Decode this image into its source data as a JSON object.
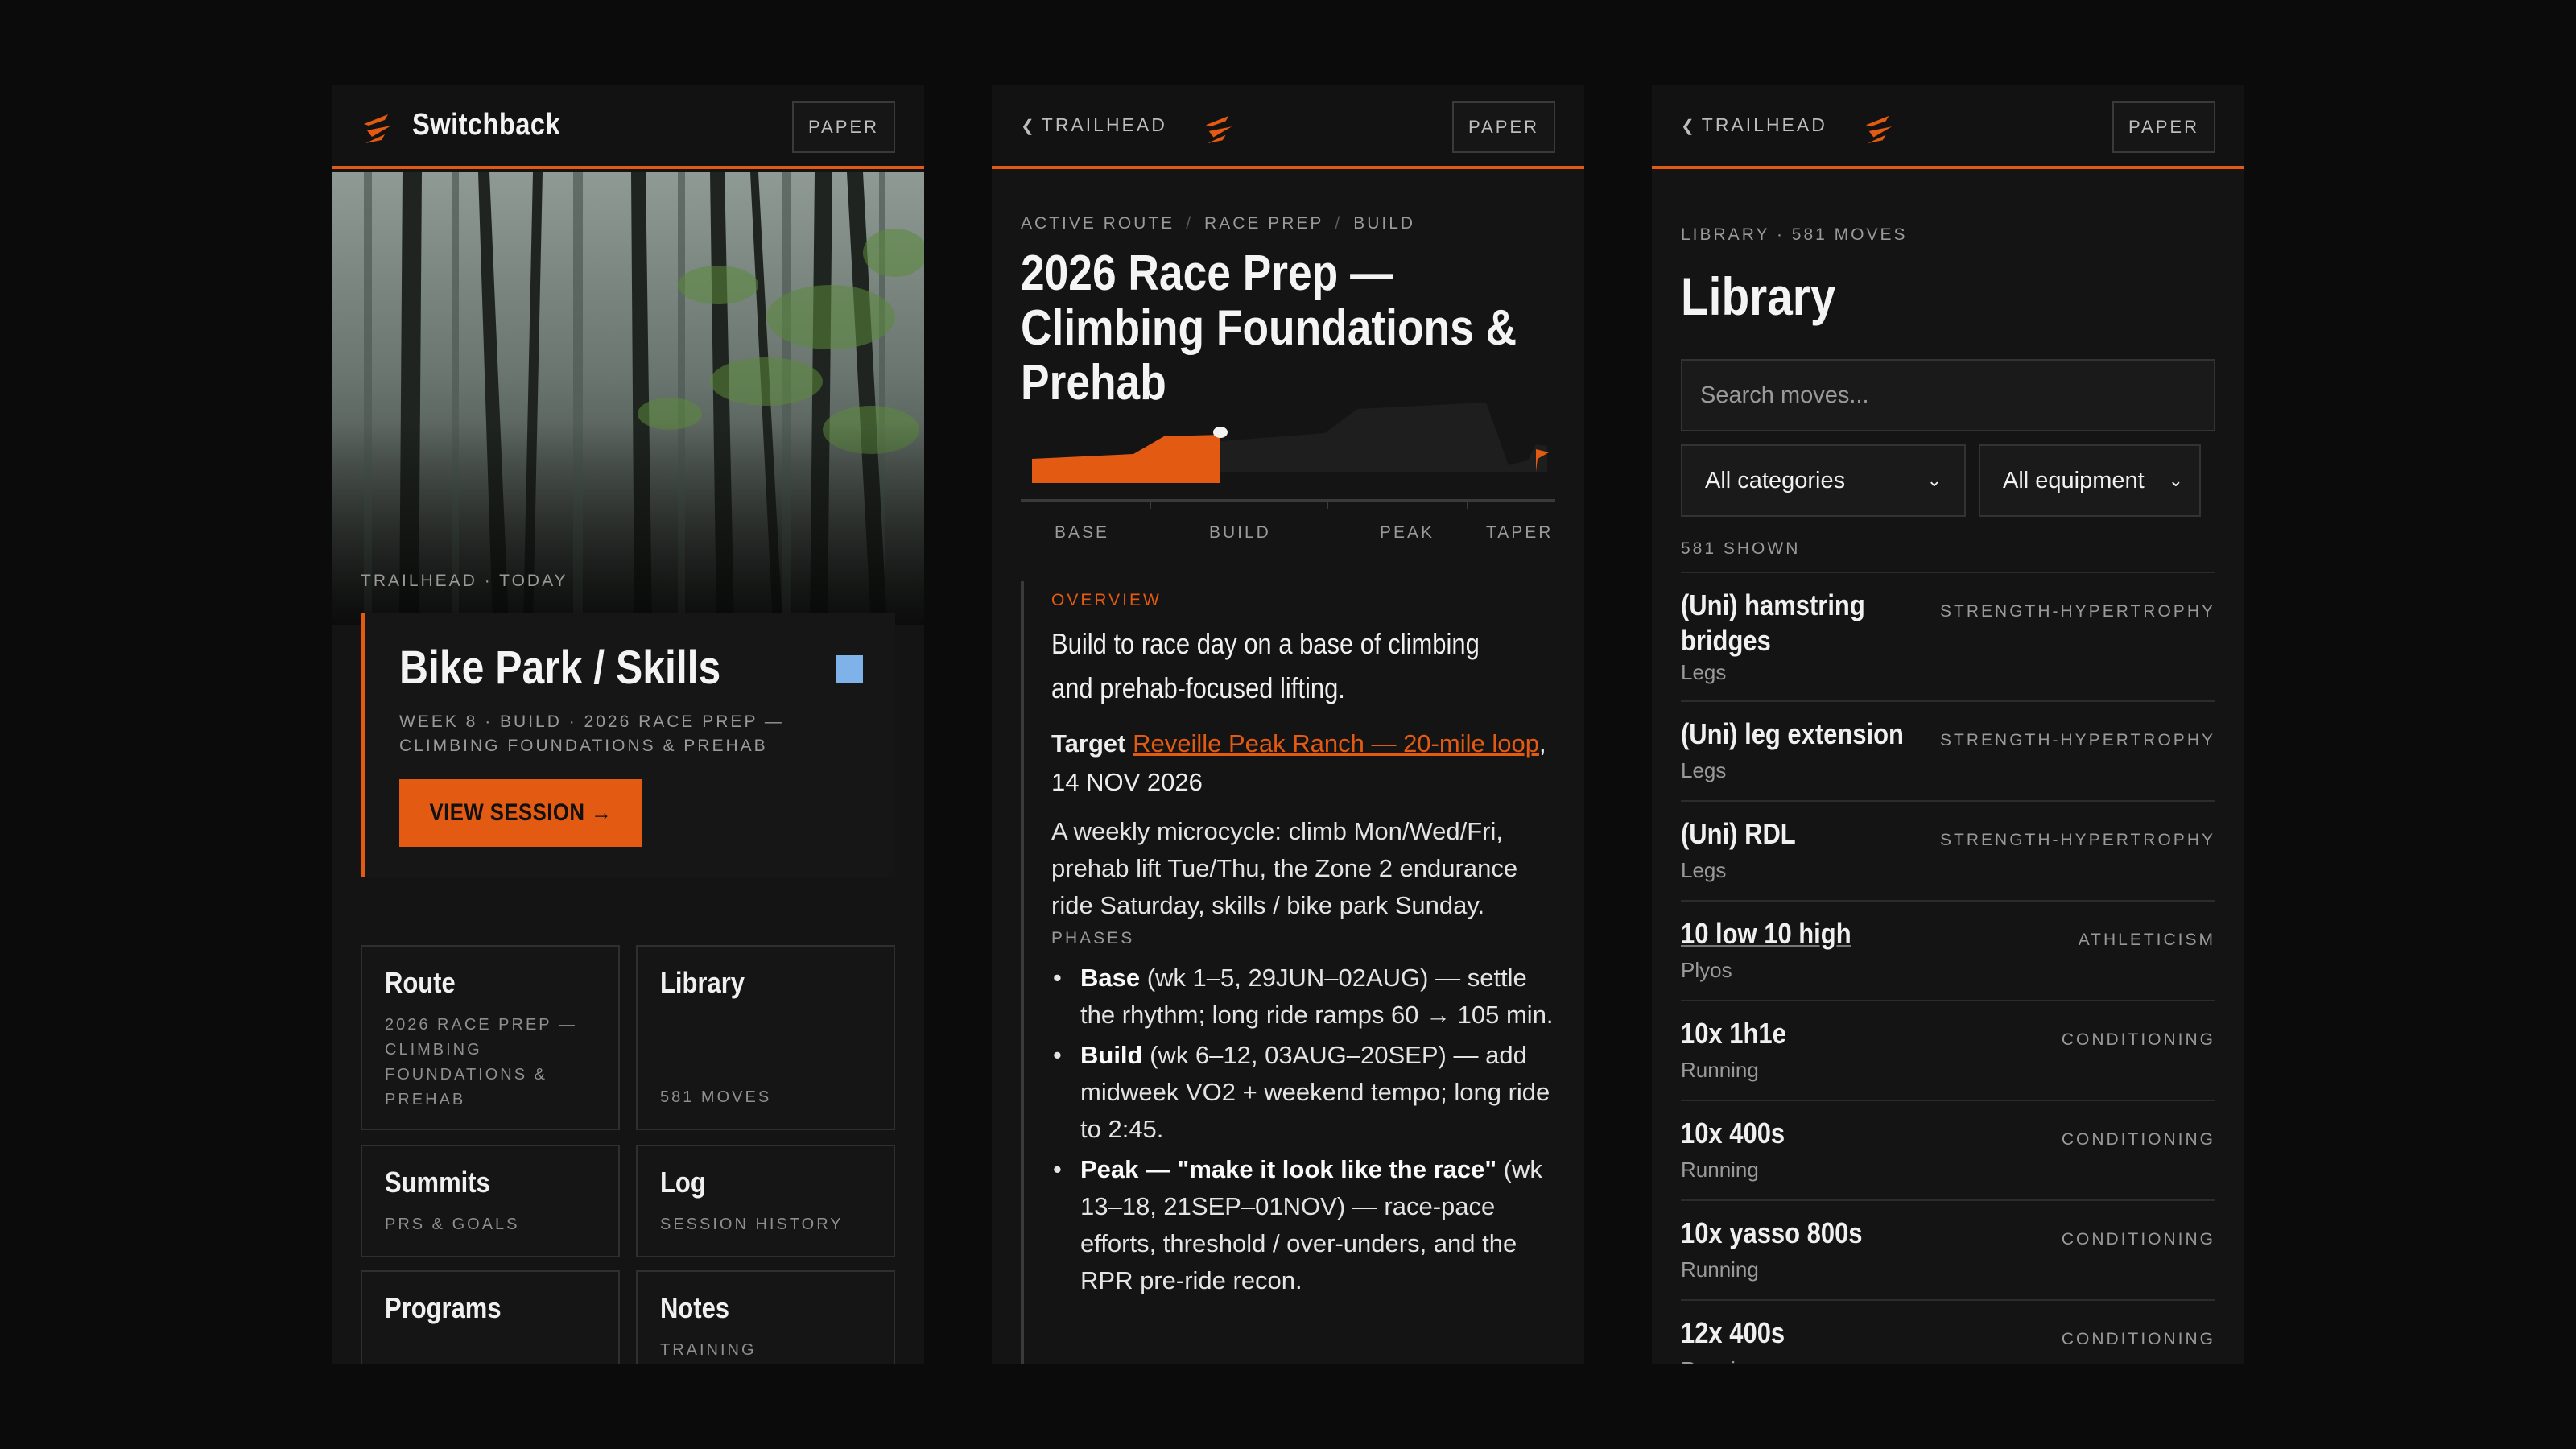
{
  "colors": {
    "accent": "#e35a12",
    "background": "#0b0b0b",
    "panel": "#141414",
    "today_chip": "#7fb2e8"
  },
  "home": {
    "brand": "Switchback",
    "paper_label": "PAPER",
    "hero_kicker": "TRAILHEAD · TODAY",
    "today": {
      "title": "Bike Park / Skills",
      "subtitle": "WEEK 8 · BUILD · 2026 RACE PREP — CLIMBING FOUNDATIONS & PREHAB",
      "cta": "VIEW SESSION →"
    },
    "tiles": [
      {
        "title": "Route",
        "sub": "2026 RACE PREP — CLIMBING FOUNDATIONS & PREHAB"
      },
      {
        "title": "Library",
        "sub": "581 MOVES"
      },
      {
        "title": "Summits",
        "sub": "PRS & GOALS"
      },
      {
        "title": "Log",
        "sub": "SESSION HISTORY"
      },
      {
        "title": "Programs",
        "sub": ""
      },
      {
        "title": "Notes",
        "sub": "TRAINING"
      }
    ]
  },
  "route": {
    "back_label": "TRAILHEAD",
    "paper_label": "PAPER",
    "breadcrumbs": [
      "ACTIVE ROUTE",
      "RACE PREP",
      "BUILD"
    ],
    "title": "2026 Race Prep — Climbing Foundations & Prehab",
    "phase_labels": [
      "BASE",
      "BUILD",
      "PEAK",
      "TAPER"
    ],
    "progress_fraction": 0.37,
    "overview_kicker": "OVERVIEW",
    "overview_lead": "Build to race day on a base of climbing and prehab-focused lifting.",
    "target_label": "Target",
    "target_link": "Reveille Peak Ranch — 20-mile loop",
    "target_date": ", 14 NOV 2026",
    "microcycle": "A weekly microcycle: climb Mon/Wed/Fri, prehab lift Tue/Thu, the Zone 2 endurance ride Saturday, skills / bike park Sunday.",
    "phases_kicker": "PHASES",
    "phases": [
      {
        "name": "Base",
        "detail": " (wk 1–5, 29JUN–02AUG) — settle the rhythm; long ride ramps 60 → 105 min."
      },
      {
        "name": "Build",
        "detail": " (wk 6–12, 03AUG–20SEP) — add midweek VO2 + weekend tempo; long ride to 2:45."
      },
      {
        "name": "Peak — \"make it look like the race\"",
        "detail": " (wk 13–18, 21SEP–01NOV) — race-pace efforts, threshold / over-unders, and the RPR pre-ride recon."
      }
    ]
  },
  "library": {
    "back_label": "TRAILHEAD",
    "paper_label": "PAPER",
    "kicker": "LIBRARY · 581 MOVES",
    "title": "Library",
    "search_placeholder": "Search moves...",
    "category_select": "All categories",
    "equipment_select": "All equipment",
    "shown_label": "581 SHOWN",
    "moves": [
      {
        "name": "(Uni) hamstring bridges",
        "category": "STRENGTH-HYPERTROPHY",
        "group": "Legs"
      },
      {
        "name": "(Uni) leg extension",
        "category": "STRENGTH-HYPERTROPHY",
        "group": "Legs"
      },
      {
        "name": "(Uni) RDL",
        "category": "STRENGTH-HYPERTROPHY",
        "group": "Legs"
      },
      {
        "name": "10 low 10 high",
        "category": "ATHLETICISM",
        "group": "Plyos"
      },
      {
        "name": "10x 1h1e",
        "category": "CONDITIONING",
        "group": "Running"
      },
      {
        "name": "10x 400s",
        "category": "CONDITIONING",
        "group": "Running"
      },
      {
        "name": "10x yasso 800s",
        "category": "CONDITIONING",
        "group": "Running"
      },
      {
        "name": "12x 400s",
        "category": "CONDITIONING",
        "group": "Running"
      }
    ]
  }
}
